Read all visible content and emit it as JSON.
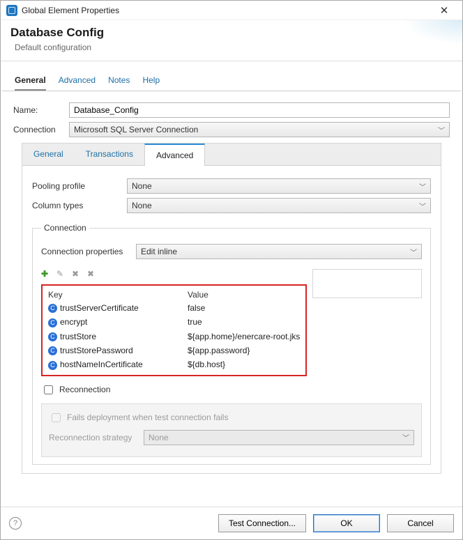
{
  "window": {
    "title": "Global Element Properties"
  },
  "header": {
    "title": "Database Config",
    "subtitle": "Default configuration"
  },
  "primary_tabs": {
    "items": [
      "General",
      "Advanced",
      "Notes",
      "Help"
    ],
    "active": "General"
  },
  "form": {
    "name_label": "Name:",
    "name_value": "Database_Config",
    "connection_label": "Connection",
    "connection_value": "Microsoft SQL Server Connection"
  },
  "sub_tabs": {
    "items": [
      "General",
      "Transactions",
      "Advanced"
    ],
    "active": "Advanced"
  },
  "advanced": {
    "pooling_label": "Pooling profile",
    "pooling_value": "None",
    "column_types_label": "Column types",
    "column_types_value": "None"
  },
  "connection_section": {
    "legend": "Connection",
    "conn_props_label": "Connection properties",
    "conn_props_value": "Edit inline",
    "toolbar_icons": {
      "add": "add-icon",
      "edit": "edit-icon",
      "delete": "delete-icon",
      "clear": "clear-icon"
    },
    "table": {
      "headers": {
        "key": "Key",
        "value": "Value"
      },
      "rows": [
        {
          "key": "trustServerCertificate",
          "value": "false"
        },
        {
          "key": "encrypt",
          "value": "true"
        },
        {
          "key": "trustStore",
          "value": "${app.home}/enercare-root.jks"
        },
        {
          "key": "trustStorePassword",
          "value": "${app.password}"
        },
        {
          "key": "hostNameInCertificate",
          "value": "${db.host}"
        }
      ]
    },
    "reconnection_label": "Reconnection",
    "reconnection_checked": false,
    "fails_label": "Fails deployment when test connection fails",
    "strategy_label": "Reconnection strategy",
    "strategy_value": "None"
  },
  "footer": {
    "test_label": "Test Connection...",
    "ok_label": "OK",
    "cancel_label": "Cancel"
  }
}
